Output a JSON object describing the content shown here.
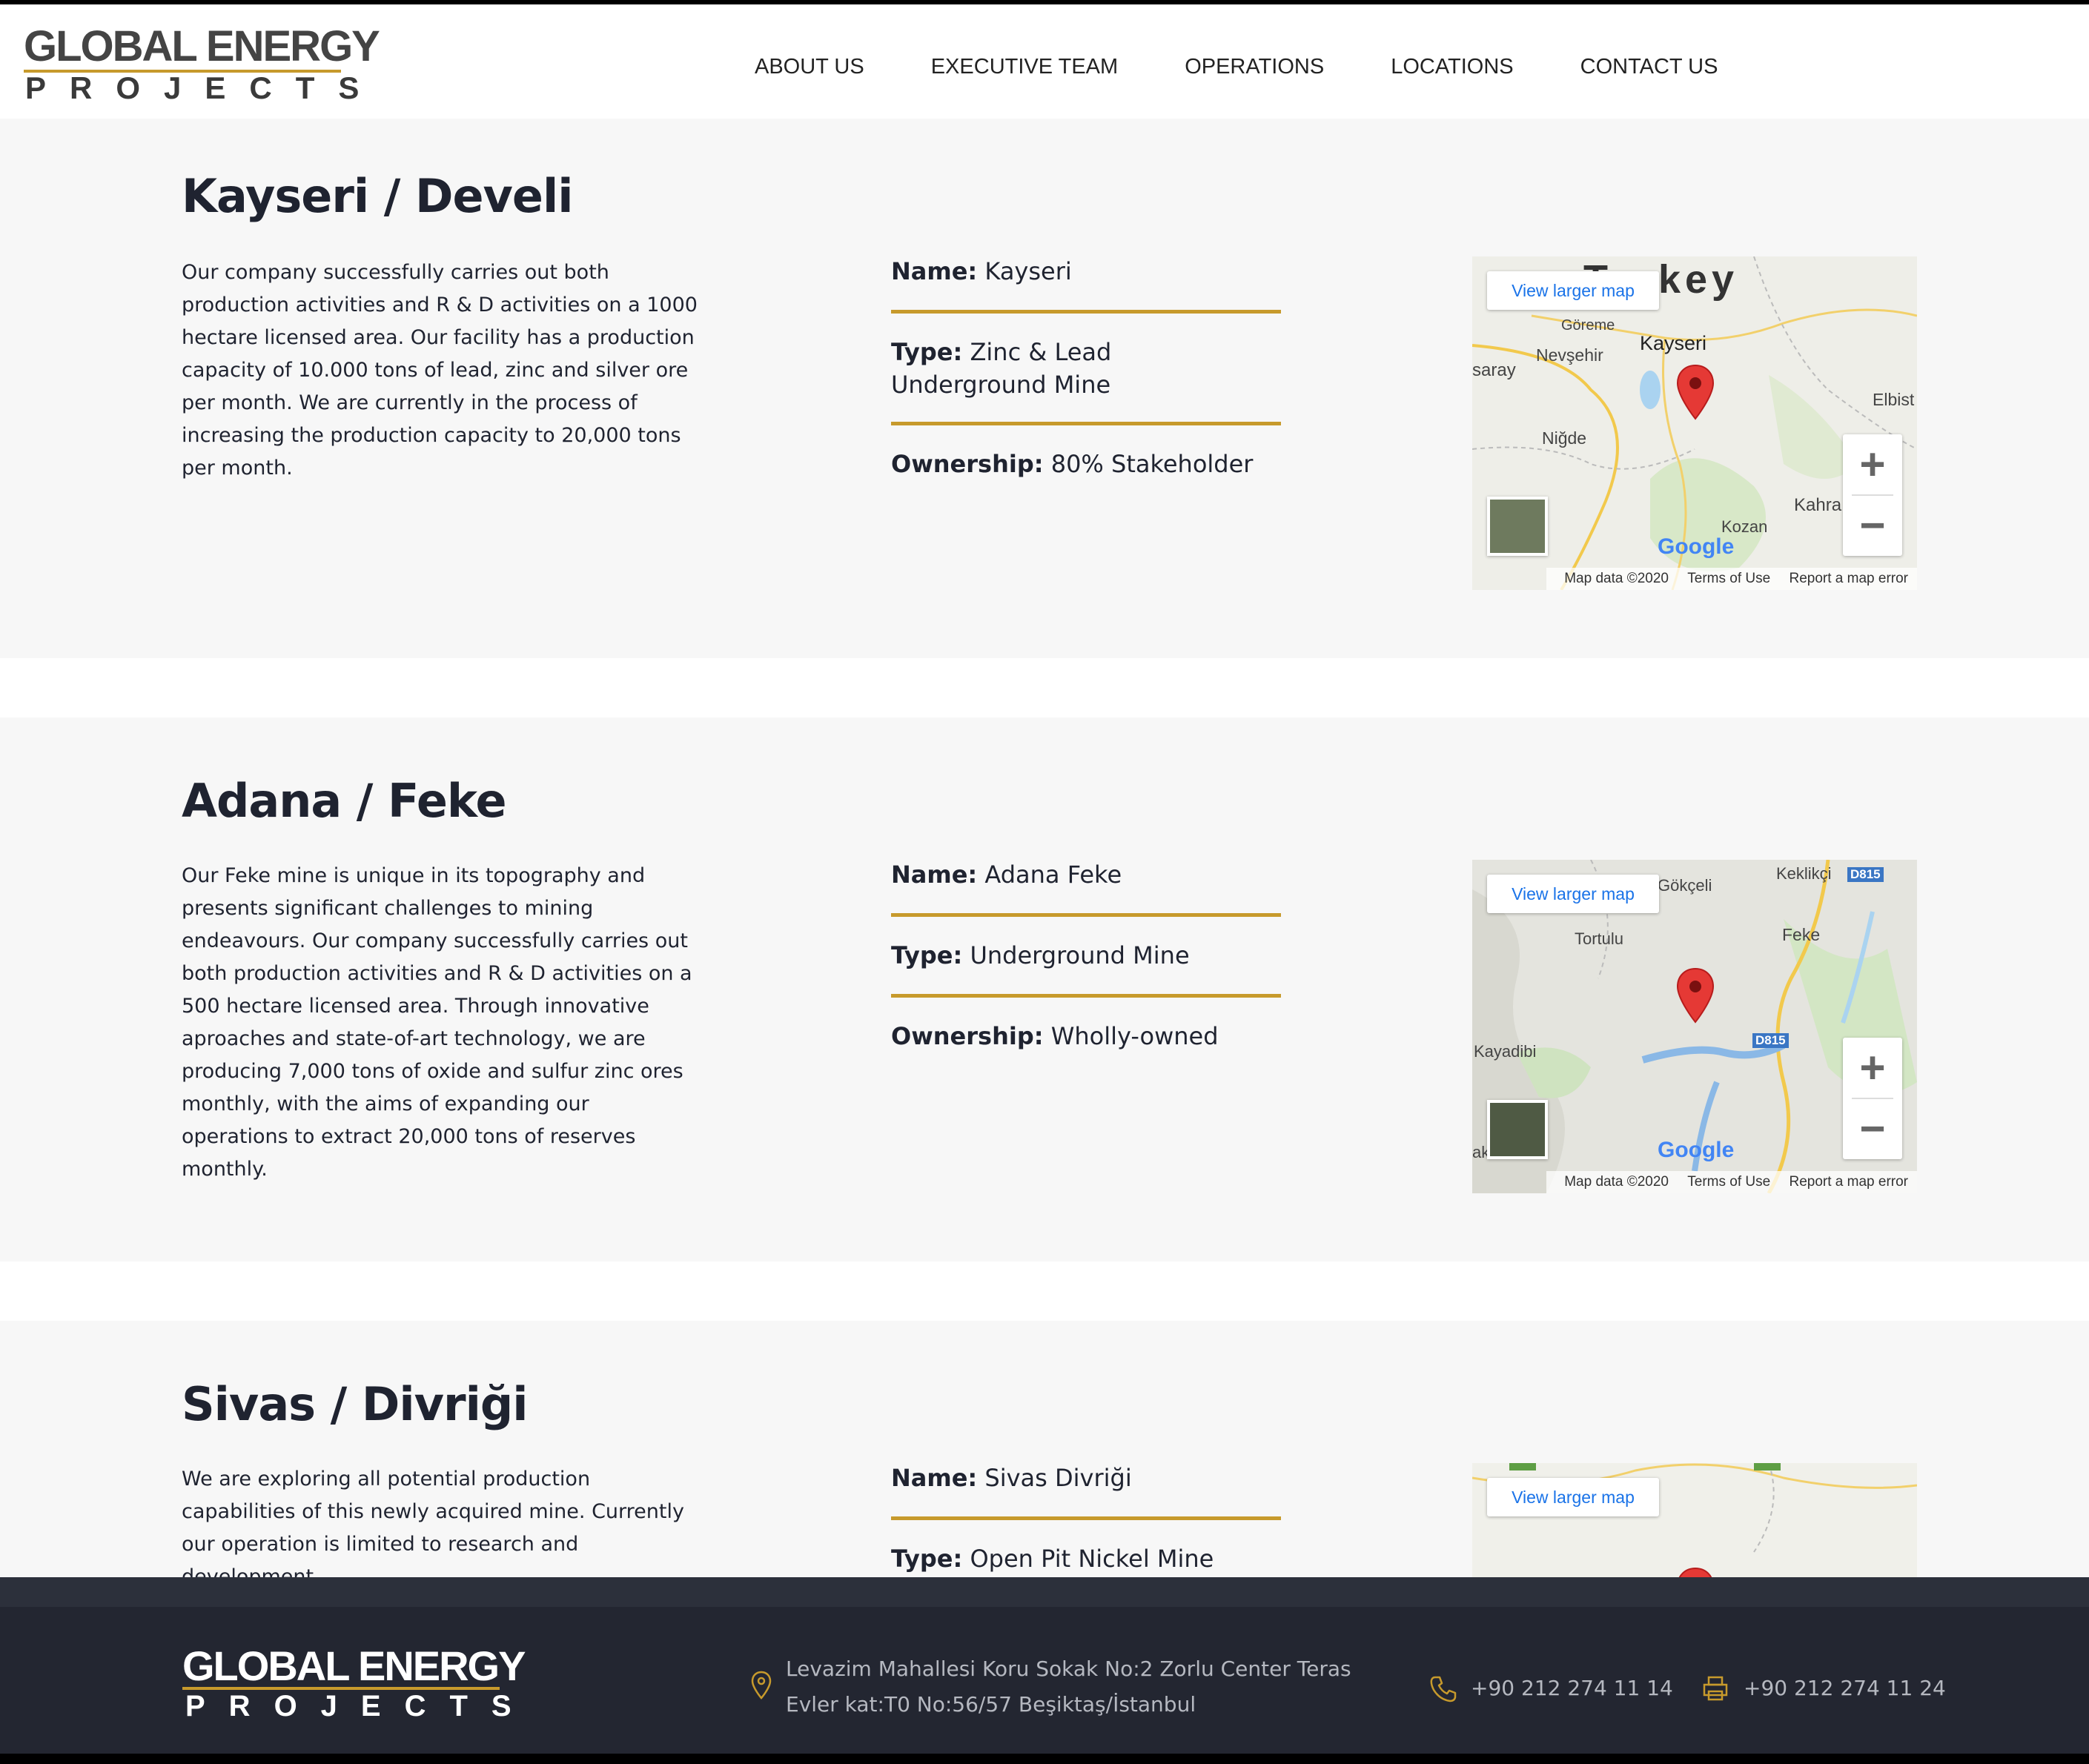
{
  "brand": {
    "logo_line1": "GLOBAL ENERGY",
    "logo_line2": "PROJECTS",
    "accent_color": "#c79a2c"
  },
  "nav": {
    "items": [
      {
        "label": "ABOUT US"
      },
      {
        "label": "EXECUTIVE TEAM"
      },
      {
        "label": "OPERATIONS"
      },
      {
        "label": "LOCATIONS"
      },
      {
        "label": "CONTACT US"
      }
    ]
  },
  "sections": [
    {
      "title": "Kayseri / Develi",
      "description": "Our company successfully carries out both production activities and R & D activities on a 1000 hectare licensed area. Our facility has a production capacity of 10.000 tons of lead, zinc and silver ore per month. We are currently in the process of increasing the production capacity to 20,000 tons per month.",
      "name_label": "Name:",
      "name_value": "Kayseri",
      "type_label": "Type:",
      "type_value": "Zinc & Lead Underground Mine",
      "ownership_label": "Ownership:",
      "ownership_value": "80% Stakeholder",
      "map": {
        "view_larger": "View larger map",
        "places": [
          "Turkey",
          "Göreme",
          "Nevşehir",
          "Kayseri",
          "saray",
          "Elbist",
          "Niğde",
          "Kahra",
          "Kozan"
        ]
      }
    },
    {
      "title": "Adana / Feke",
      "description": "Our Feke mine is unique in its topography and presents significant challenges to mining endeavours. Our company successfully carries out both production activities and R & D activities on a 500 hectare licensed area. Through innovative aproaches and state-of-art technology, we are producing 7,000 tons of oxide and sulfur zinc ores monthly, with the aims of expanding our operations to extract 20,000 tons of reserves monthly.",
      "name_label": "Name:",
      "name_value": "Adana Feke",
      "type_label": "Type:",
      "type_value": "Underground Mine",
      "ownership_label": "Ownership:",
      "ownership_value": "Wholly-owned",
      "map": {
        "view_larger": "View larger map",
        "places": [
          "Gökçeli",
          "Keklikçi",
          "D815",
          "Tortulu",
          "Feke",
          "Kayadibi",
          "D815",
          "ak"
        ]
      }
    },
    {
      "title": "Sivas / Divriği",
      "description": "We are exploring all potential production capabilities of this newly acquired mine. Currently our operation is limited to research and development.",
      "name_label": "Name:",
      "name_value": "Sivas Divriği",
      "type_label": "Type:",
      "type_value": "Open Pit Nickel Mine",
      "map": {
        "view_larger": "View larger map"
      }
    }
  ],
  "map_common": {
    "google": "Google",
    "map_data": "Map data ©2020",
    "terms": "Terms of Use",
    "report": "Report a map error",
    "zoom_in": "+",
    "zoom_out": "−"
  },
  "footer": {
    "address": "Levazim Mahallesi Koru Sokak No:2 Zorlu Center Teras Evler kat:T0 No:56/57 Beşiktaş/İstanbul",
    "phone": "+90 212 274 11 14",
    "fax": "+90 212 274 11 24",
    "bg_color": "#232631"
  }
}
